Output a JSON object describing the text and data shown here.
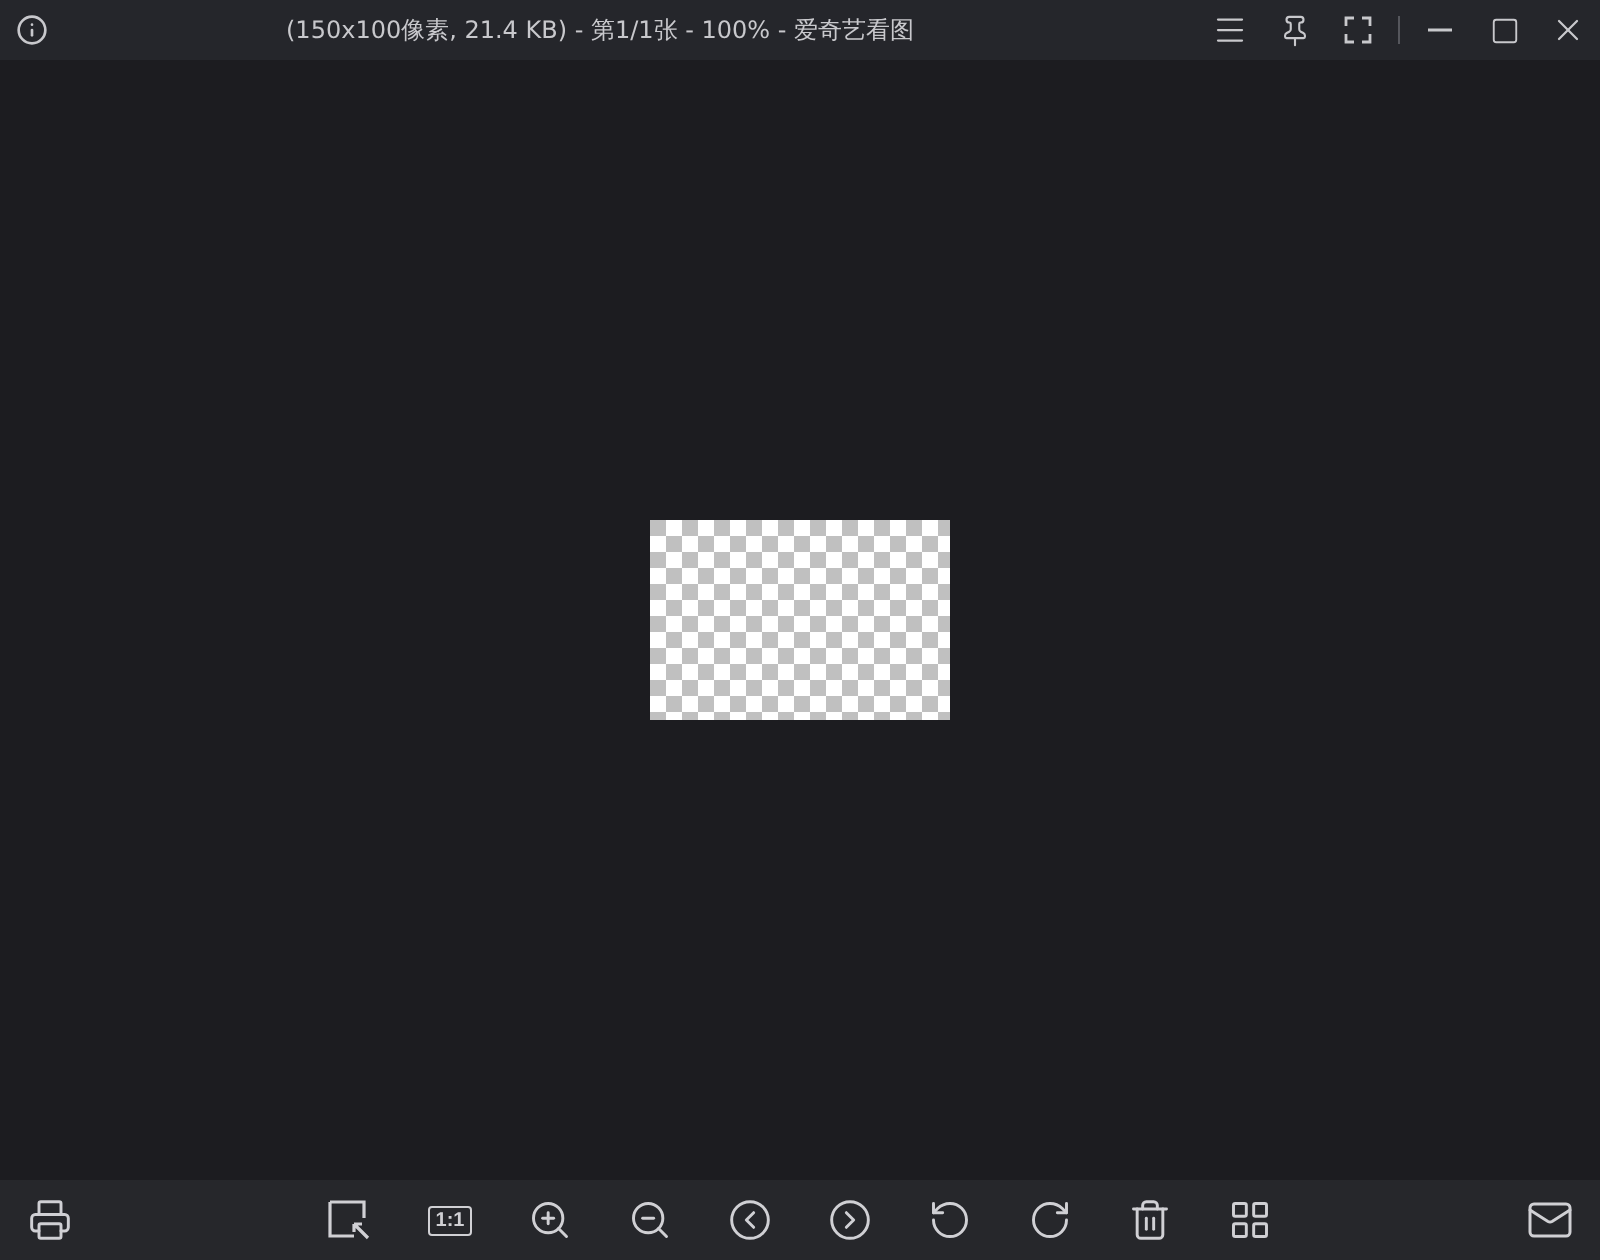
{
  "window": {
    "title": "(150x100像素, 21.4 KB) - 第1/1张 - 100% - 爱奇艺看图"
  },
  "toolbar": {
    "actual_size_label": "1:1"
  }
}
